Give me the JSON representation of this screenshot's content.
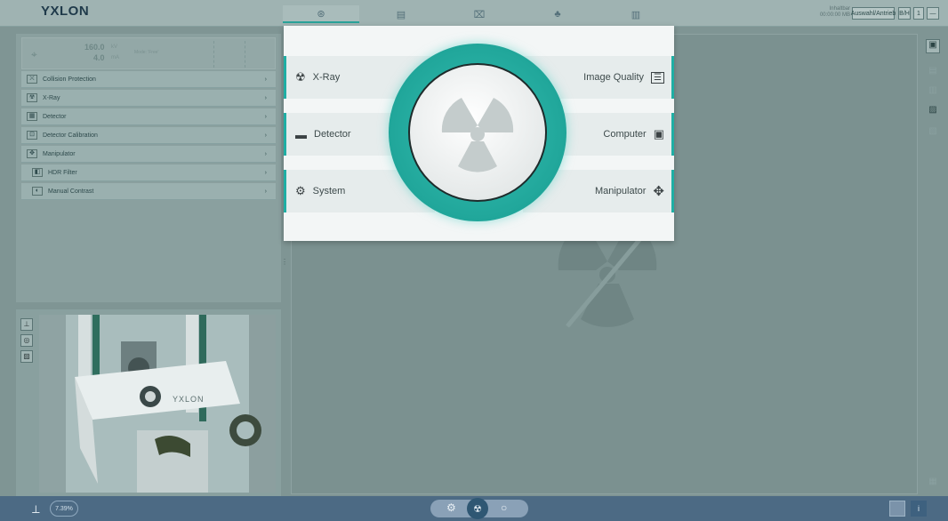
{
  "app": {
    "logo": "YXLON"
  },
  "top_tabs": [
    {
      "icon": "⊛",
      "name": "radiation"
    },
    {
      "icon": "▤",
      "name": "layout"
    },
    {
      "icon": "⌧",
      "name": "graph"
    },
    {
      "icon": "♣",
      "name": "person-tools"
    },
    {
      "icon": "▥",
      "name": "document"
    }
  ],
  "top_right": {
    "status_line1": "Inhaltbar",
    "status_line2": "00:00:00 MB",
    "button1": "Auswahl/Antrieb",
    "button2": "B/H",
    "button3": "1",
    "button4": "—"
  },
  "sensor": {
    "value1": "160.0",
    "unit1": "kV",
    "value2": "4.0",
    "unit2": "mA",
    "mode": "Mode: 'Free'"
  },
  "left_menu": [
    {
      "label": "Collision Protection",
      "icon": "⛌"
    },
    {
      "label": "X-Ray",
      "icon": "☢"
    },
    {
      "label": "Detector",
      "icon": "▦"
    },
    {
      "label": "Detector Calibration",
      "icon": "⊡"
    },
    {
      "label": "Manipulator",
      "icon": "✥"
    },
    {
      "label": "HDR Filter",
      "icon": "◧"
    },
    {
      "label": "Manual Contrast",
      "icon": "◐"
    }
  ],
  "camera": {
    "brand": "YXLON"
  },
  "popup": {
    "left": [
      {
        "label": "X-Ray",
        "icon": "☢"
      },
      {
        "label": "Detector",
        "icon": "▬"
      },
      {
        "label": "System",
        "icon": "⚙"
      }
    ],
    "right": [
      {
        "label": "Image Quality",
        "icon": "☰"
      },
      {
        "label": "Computer",
        "icon": "▣"
      },
      {
        "label": "Manipulator",
        "icon": "✥"
      }
    ]
  },
  "bottom": {
    "progress": "7.39%"
  },
  "colors": {
    "accent": "#1faea4",
    "bottom_bar": "#4c6a84"
  }
}
